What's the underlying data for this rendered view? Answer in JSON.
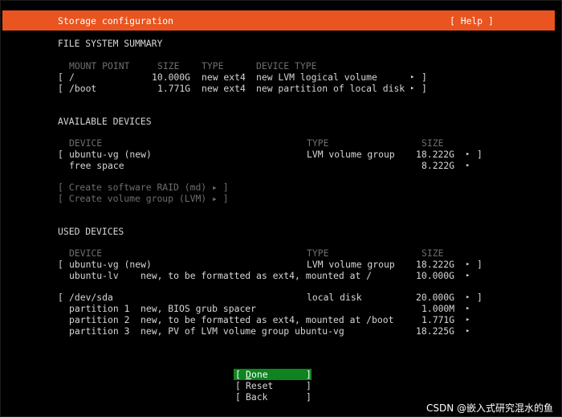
{
  "header": {
    "title": "Storage configuration",
    "help": "[ Help ]"
  },
  "fs_summary": {
    "heading": "FILE SYSTEM SUMMARY",
    "columns": [
      "MOUNT POINT",
      "SIZE",
      "TYPE",
      "DEVICE TYPE"
    ],
    "rows": [
      {
        "bracket": "[",
        "mount": "/",
        "size": "10.000G",
        "type": "new ext4",
        "device_type": "new LVM logical volume",
        "arrow": "▸",
        "close": "]"
      },
      {
        "bracket": "[",
        "mount": "/boot",
        "size": "1.771G",
        "type": "new ext4",
        "device_type": "new partition of local disk",
        "arrow": "▸",
        "close": "]"
      }
    ]
  },
  "available": {
    "heading": "AVAILABLE DEVICES",
    "columns": [
      "DEVICE",
      "TYPE",
      "SIZE"
    ],
    "rows": [
      {
        "bracket": "[",
        "device": "ubuntu-vg (new)",
        "type": "LVM volume group",
        "size": "18.222G",
        "arrow": "▸",
        "close": "]"
      },
      {
        "device": "free space",
        "size": "8.222G",
        "arrow": "▸"
      }
    ],
    "actions": [
      "[ Create software RAID (md) ▸ ]",
      "[ Create volume group (LVM) ▸ ]"
    ]
  },
  "used": {
    "heading": "USED DEVICES",
    "columns": [
      "DEVICE",
      "TYPE",
      "SIZE"
    ],
    "rows": [
      {
        "bracket": "[",
        "device": "ubuntu-vg (new)",
        "type": "LVM volume group",
        "size": "18.222G",
        "arrow": "▸",
        "close": "]"
      },
      {
        "device": "ubuntu-lv",
        "desc": "new, to be formatted as ext4, mounted at /",
        "size": "10.000G",
        "arrow": "▸"
      },
      {
        "bracket": "[",
        "device": "/dev/sda",
        "type": "local disk",
        "size": "20.000G",
        "arrow": "▸",
        "close": "]"
      },
      {
        "device": "partition 1",
        "desc": "new, BIOS grub spacer",
        "size": "1.000M",
        "arrow": "▸"
      },
      {
        "device": "partition 2",
        "desc": "new, to be formatted as ext4, mounted at /boot",
        "size": "1.771G",
        "arrow": "▸"
      },
      {
        "device": "partition 3",
        "desc": "new, PV of LVM volume group ubuntu-vg",
        "size": "18.225G",
        "arrow": "▸"
      }
    ]
  },
  "buttons": {
    "done": {
      "open": "[ ",
      "hotkey": "D",
      "rest": "one",
      "close": "]"
    },
    "reset": {
      "open": "[ ",
      "label": "Reset",
      "close": "]"
    },
    "back": {
      "open": "[ ",
      "label": "Back",
      "close": "]"
    }
  },
  "watermark": "CSDN @嵌入式研究混水的鱼",
  "colors": {
    "header_bg": "#e95420",
    "focus_bg": "#0e8420",
    "bg": "#000000"
  }
}
